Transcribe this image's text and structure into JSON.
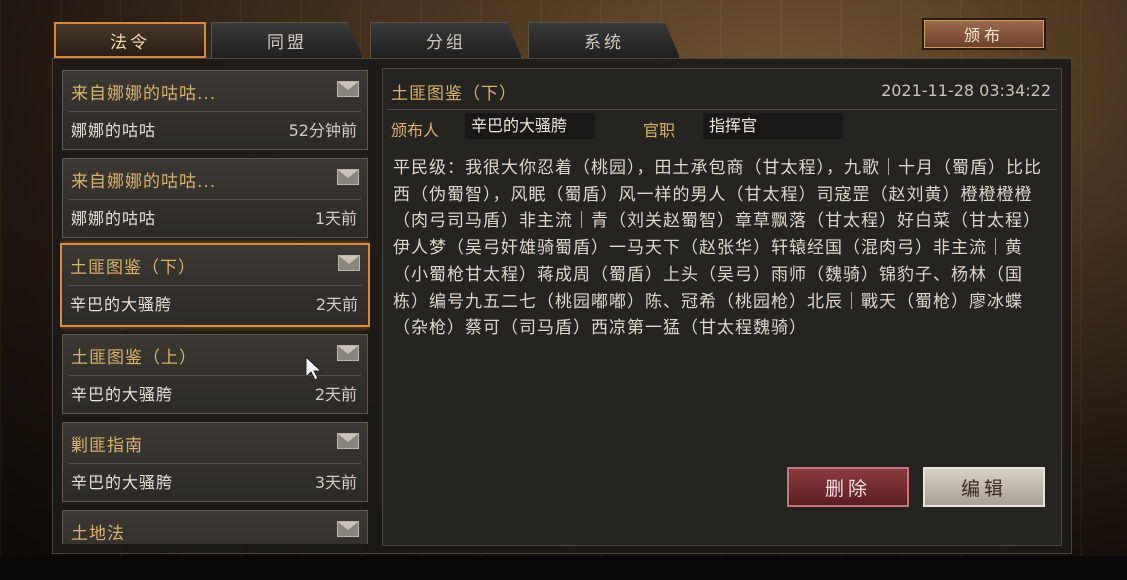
{
  "tabs": [
    {
      "label": "法令",
      "active": true
    },
    {
      "label": "同盟",
      "active": false
    },
    {
      "label": "分组",
      "active": false
    },
    {
      "label": "系统",
      "active": false
    }
  ],
  "publish_label": "颁布",
  "mails": [
    {
      "title": "来自娜娜的咕咕...",
      "from": "娜娜的咕咕",
      "time": "52分钟前",
      "selected": false
    },
    {
      "title": "来自娜娜的咕咕...",
      "from": "娜娜的咕咕",
      "time": "1天前",
      "selected": false
    },
    {
      "title": "土匪图鉴（下）",
      "from": "辛巴的大骚胯",
      "time": "2天前",
      "selected": true
    },
    {
      "title": "土匪图鉴（上）",
      "from": "辛巴的大骚胯",
      "time": "2天前",
      "selected": false
    },
    {
      "title": "剿匪指南",
      "from": "辛巴的大骚胯",
      "time": "3天前",
      "selected": false
    },
    {
      "title": "土地法",
      "from": "",
      "time": "",
      "selected": false
    }
  ],
  "detail": {
    "title": "土匪图鉴（下）",
    "date": "2021-11-28 03:34:22",
    "publisher_label": "颁布人",
    "publisher": "辛巴的大骚胯",
    "position_label": "官职",
    "position": "指挥官",
    "content": "平民级：我很大你忍着（桃园），田土承包商（甘太程），九歌｜十月（蜀盾）比比西（伪蜀智），风眠（蜀盾）风一样的男人（甘太程）司寇罡（赵刘黄）橙橙橙橙（肉弓司马盾）非主流｜青（刘关赵蜀智）章草飘落（甘太程）好白菜（甘太程）伊人梦（吴弓奸雄骑蜀盾）一马天下（赵张华）轩辕经国（混肉弓）非主流｜黄（小蜀枪甘太程）蒋成周（蜀盾）上头（吴弓）雨师（魏骑）锦豹子、杨林（国栋）编号九五二七（桃园嘟嘟）陈、冠希（桃园枪）北辰｜戰天（蜀枪）廖冰蝶（杂枪）蔡可（司马盾）西凉第一猛（甘太程魏骑）"
  },
  "buttons": {
    "delete": "删除",
    "edit": "编辑"
  }
}
